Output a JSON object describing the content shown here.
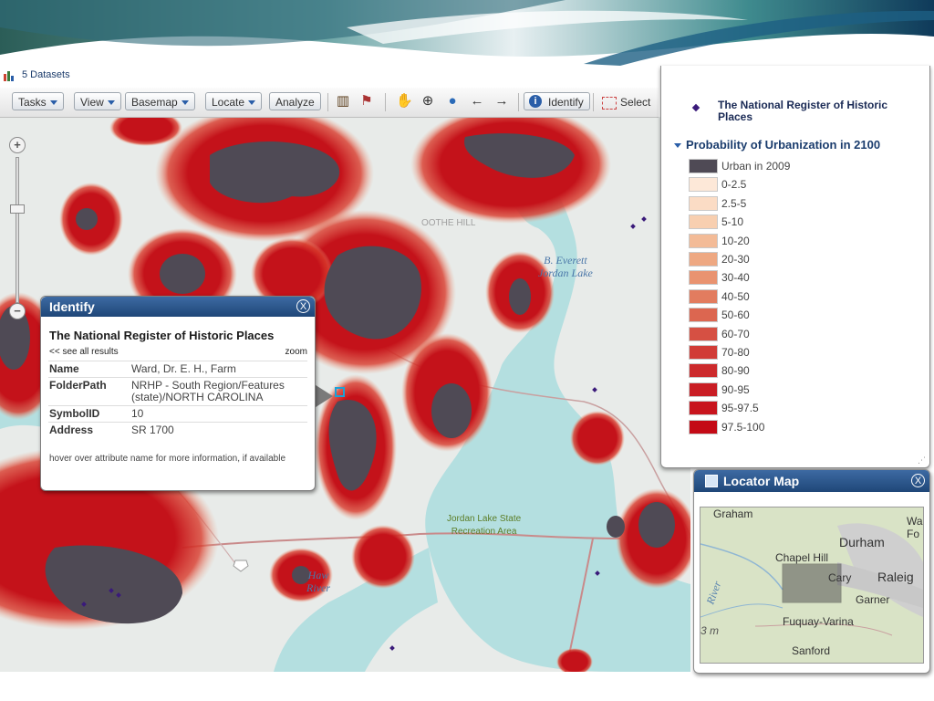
{
  "datasets": {
    "label": "5 Datasets"
  },
  "toolbar": {
    "tasks": "Tasks",
    "view": "View",
    "basemap": "Basemap",
    "locate": "Locate",
    "analyze": "Analyze",
    "identify": "Identify",
    "select": "Select"
  },
  "identify": {
    "title": "Identify",
    "layer_title": "The National Register of Historic Places",
    "see_all": "<< see all results",
    "zoom": "zoom",
    "attributes": [
      {
        "name": "Name",
        "value": "Ward, Dr. E. H., Farm"
      },
      {
        "name": "FolderPath",
        "value": "NRHP - South Region/Features (state)/NORTH CAROLINA"
      },
      {
        "name": "SymbolID",
        "value": "10"
      },
      {
        "name": "Address",
        "value": "SR 1700"
      }
    ],
    "hint": "hover over attribute name for more information, if available",
    "close": "X"
  },
  "legend": {
    "nrhp_label": "The National Register of Historic Places",
    "group_title": "Probability of Urbanization in 2100",
    "classes": [
      {
        "label": "Urban in 2009",
        "color": "#4f4a55"
      },
      {
        "label": "0-2.5",
        "color": "#fde8d8"
      },
      {
        "label": "2.5-5",
        "color": "#fbdcc5"
      },
      {
        "label": "5-10",
        "color": "#f8cfb0"
      },
      {
        "label": "10-20",
        "color": "#f3bb97"
      },
      {
        "label": "20-30",
        "color": "#eea882"
      },
      {
        "label": "30-40",
        "color": "#e99370"
      },
      {
        "label": "40-50",
        "color": "#e27c5f"
      },
      {
        "label": "50-60",
        "color": "#dc6650"
      },
      {
        "label": "60-70",
        "color": "#d65043"
      },
      {
        "label": "70-80",
        "color": "#d13c37"
      },
      {
        "label": "80-90",
        "color": "#cc2a2c"
      },
      {
        "label": "90-95",
        "color": "#c91d24"
      },
      {
        "label": "95-97.5",
        "color": "#c8141d"
      },
      {
        "label": "97.5-100",
        "color": "#c40a16"
      }
    ]
  },
  "locator": {
    "title": "Locator Map",
    "close": "X",
    "places": [
      "Graham",
      "Durham",
      "Chapel Hill",
      "Cary",
      "Raleig",
      "Garner",
      "Fuquay-Varina",
      "Sanford",
      "Wa",
      "Fo",
      "River",
      "3 m"
    ]
  },
  "map": {
    "labels": [
      "B. Everett",
      "Jordan Lake",
      "Jordan Lake State",
      "Recreation Area",
      "Haw",
      "River",
      "OOTHE HILL"
    ]
  }
}
